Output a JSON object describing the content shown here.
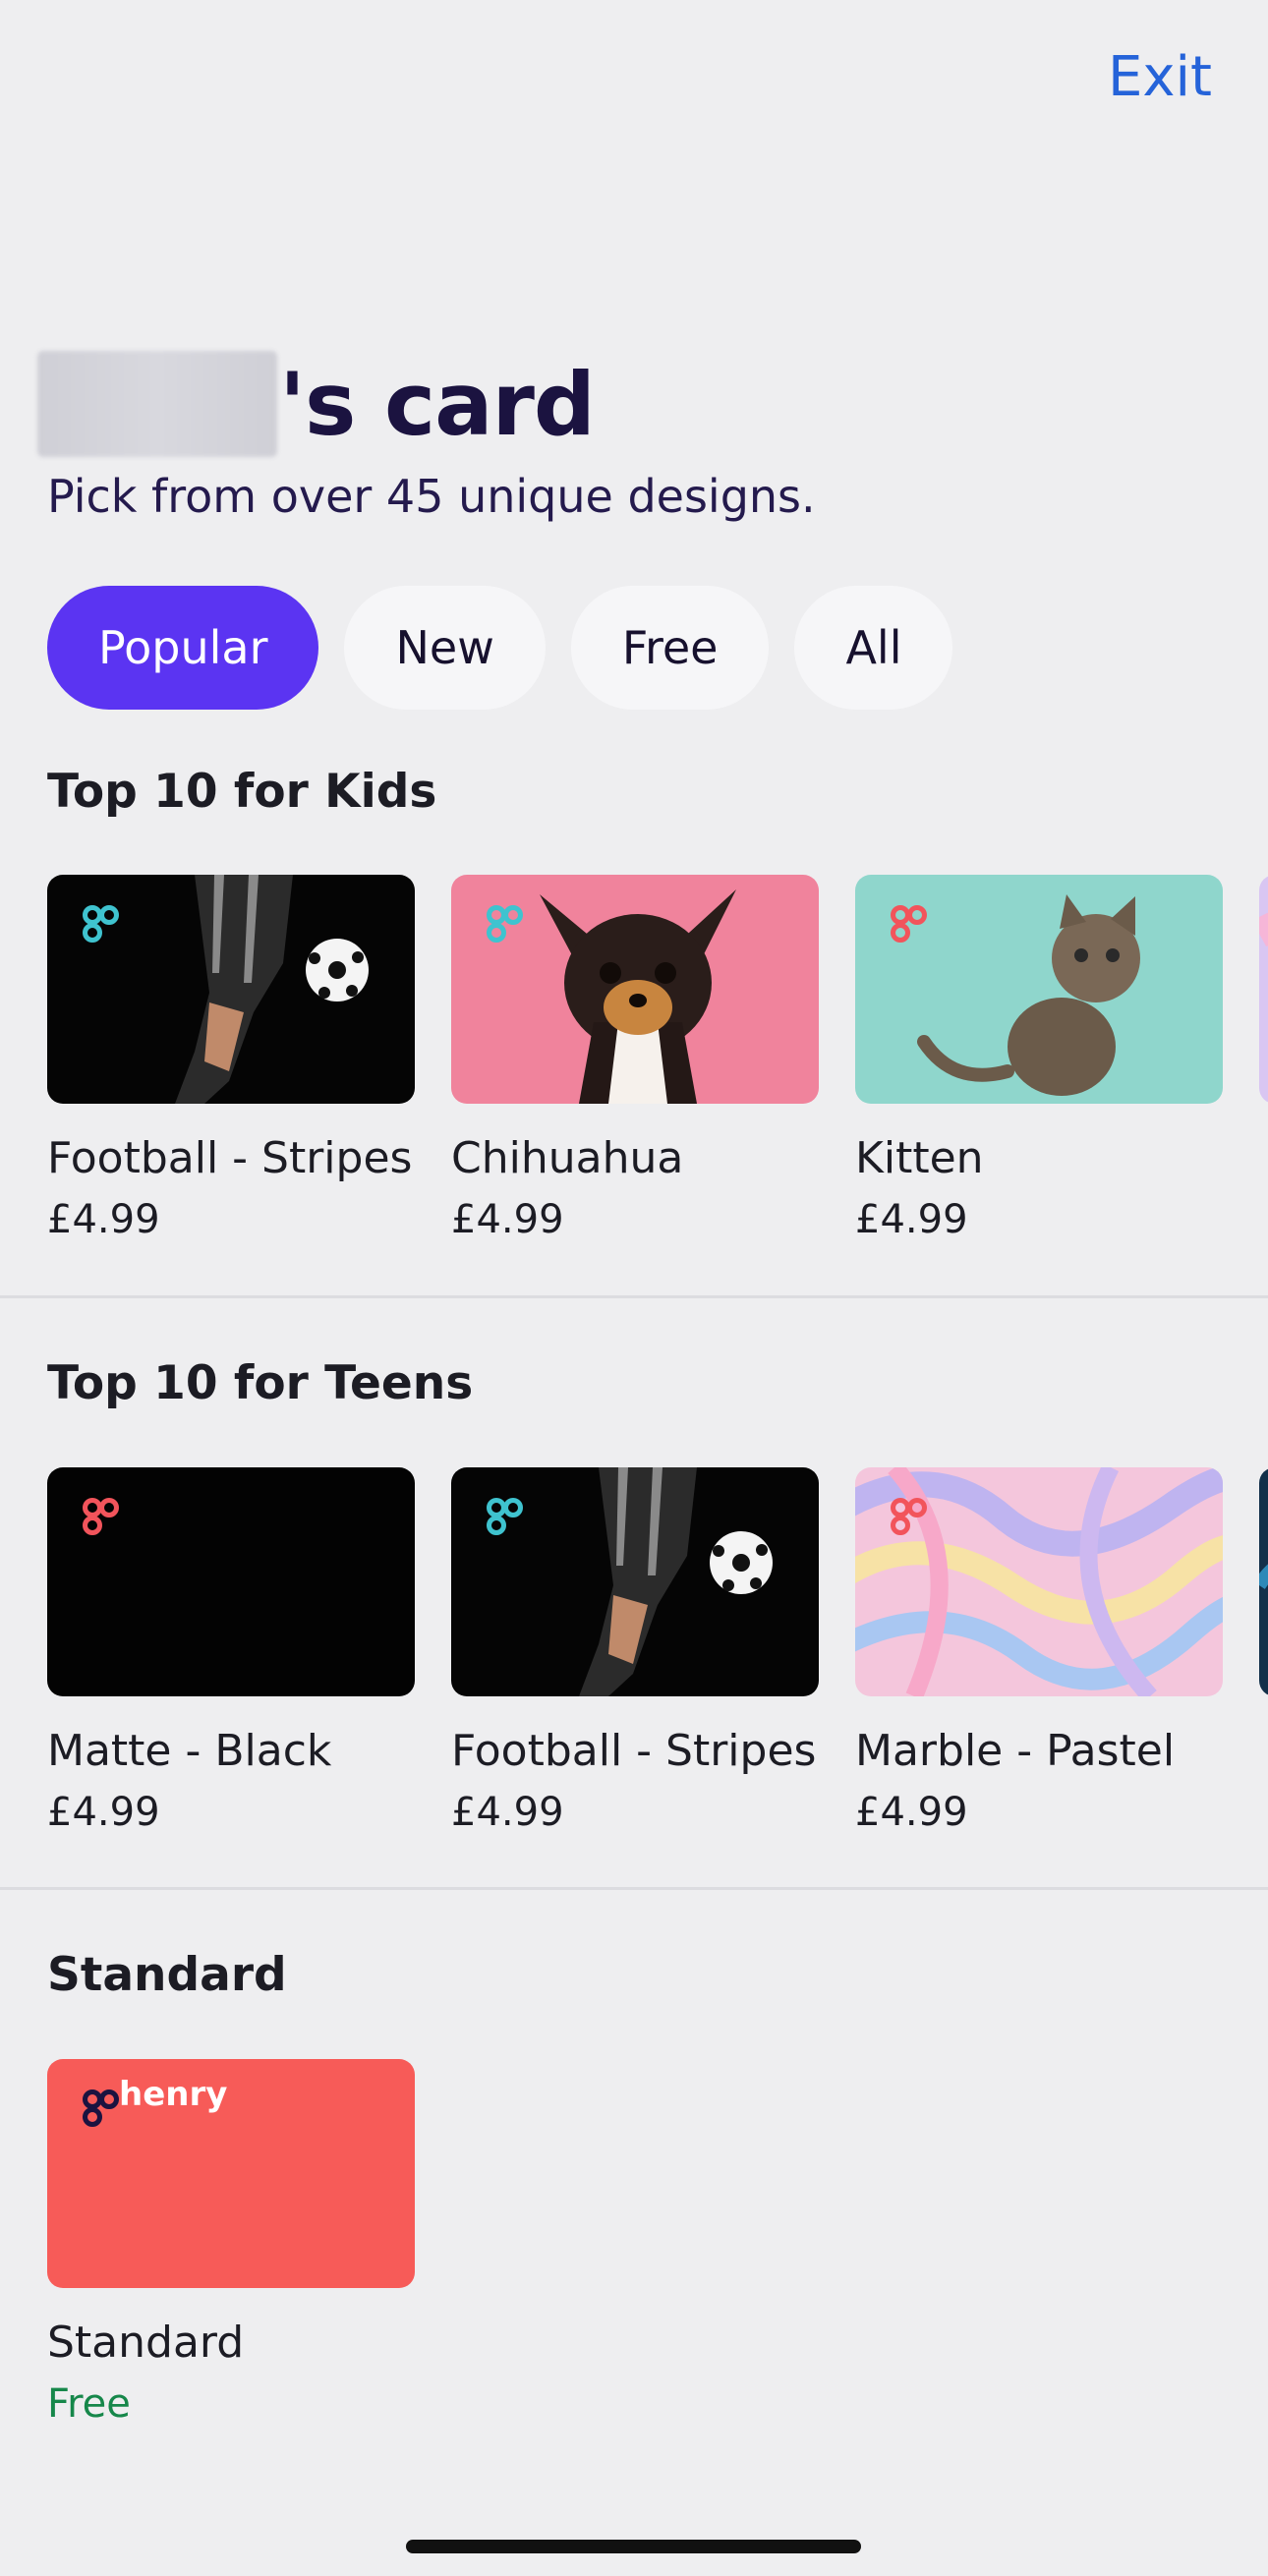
{
  "header": {
    "exit_label": "Exit"
  },
  "title": {
    "suffix": "'s card",
    "subtitle": "Pick from over 45 unique designs."
  },
  "tabs": [
    {
      "label": "Popular",
      "active": true
    },
    {
      "label": "New",
      "active": false
    },
    {
      "label": "Free",
      "active": false
    },
    {
      "label": "All",
      "active": false
    }
  ],
  "sections": [
    {
      "title": "Top 10 for Kids",
      "cards": [
        {
          "name": "Football - Stripes",
          "price": "£4.99",
          "design": "football",
          "logo_color": "#3fc3cf"
        },
        {
          "name": "Chihuahua",
          "price": "£4.99",
          "design": "chihuahua",
          "logo_color": "#3fc3cf"
        },
        {
          "name": "Kitten",
          "price": "£4.99",
          "design": "kitten",
          "logo_color": "#f2545b"
        },
        {
          "name": "",
          "price": "",
          "design": "pastel",
          "logo_color": "#f2545b"
        }
      ]
    },
    {
      "title": "Top 10 for Teens",
      "cards": [
        {
          "name": "Matte - Black",
          "price": "£4.99",
          "design": "black",
          "logo_color": "#f2545b"
        },
        {
          "name": "Football - Stripes",
          "price": "£4.99",
          "design": "football",
          "logo_color": "#3fc3cf"
        },
        {
          "name": "Marble - Pastel",
          "price": "£4.99",
          "design": "marble",
          "logo_color": "#f2545b"
        },
        {
          "name": "",
          "price": "",
          "design": "dark-blue",
          "logo_color": "#3fc3cf"
        }
      ]
    },
    {
      "title": "Standard",
      "cards": [
        {
          "name": "Standard",
          "price": "Free",
          "design": "standard",
          "logo_color": "#1b1340",
          "brand": "henry"
        }
      ]
    }
  ]
}
